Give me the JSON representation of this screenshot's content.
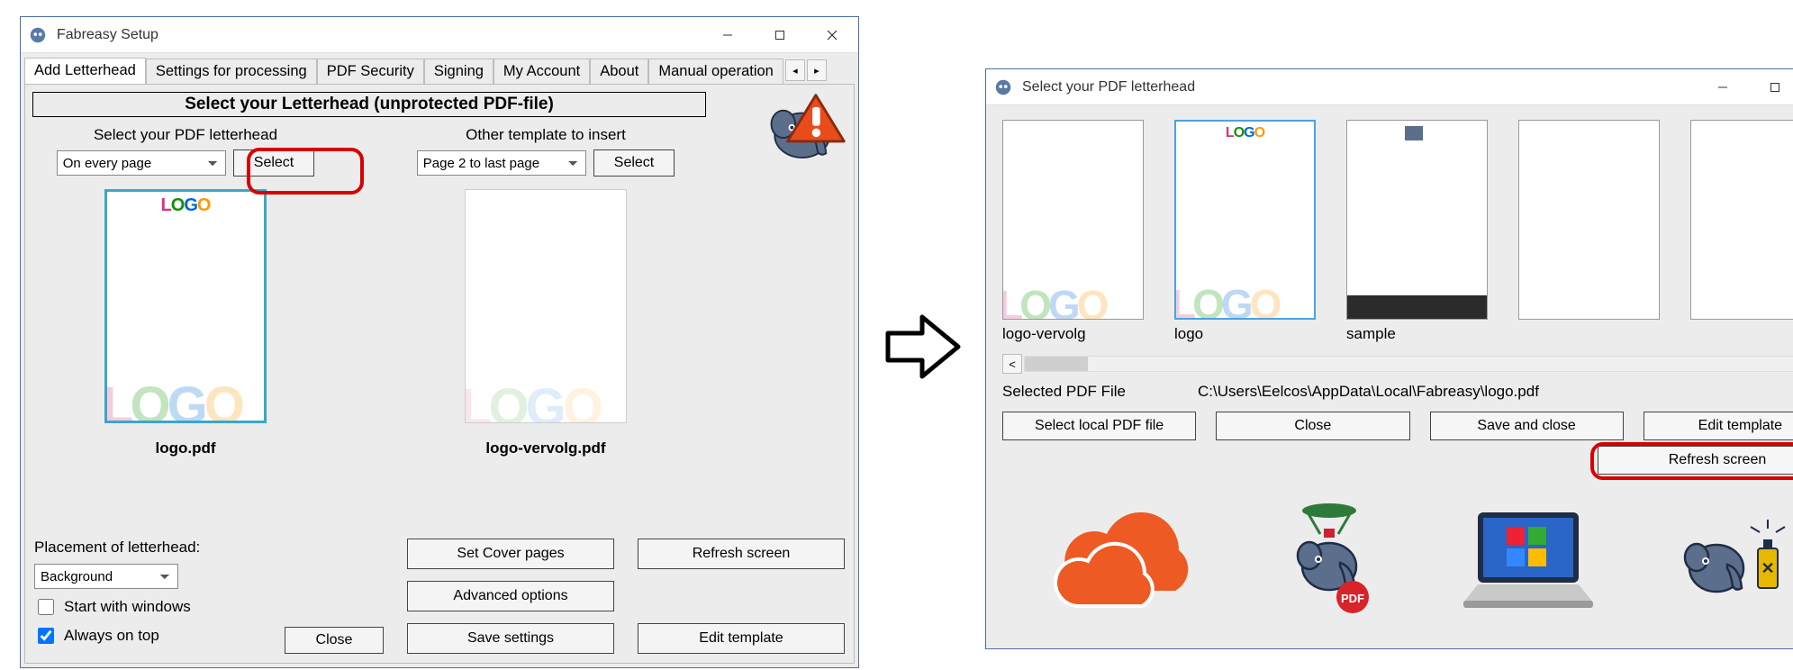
{
  "win1": {
    "title": "Fabreasy Setup",
    "tabs": [
      "Add Letterhead",
      "Settings for processing",
      "PDF Security",
      "Signing",
      "My Account",
      "About",
      "Manual operation"
    ],
    "heading": "Select your Letterhead (unprotected PDF-file)",
    "left": {
      "label": "Select your PDF letterhead",
      "dropdown": "On every page",
      "select_btn": "Select",
      "filename": "logo.pdf"
    },
    "right": {
      "label": "Other template to insert",
      "dropdown": "Page 2 to last page",
      "select_btn": "Select",
      "filename": "logo-vervolg.pdf"
    },
    "placement_label": "Placement of letterhead:",
    "placement_value": "Background",
    "start_with_windows": "Start with windows",
    "always_on_top": "Always on top",
    "btn_close": "Close",
    "btn_set_cover": "Set Cover pages",
    "btn_refresh": "Refresh screen",
    "btn_advanced": "Advanced options",
    "btn_save": "Save settings",
    "btn_edit": "Edit template"
  },
  "win2": {
    "title": "Select your PDF letterhead",
    "thumbs": [
      "logo-vervolg",
      "logo",
      "sample",
      "",
      ""
    ],
    "selected_label": "Selected PDF File",
    "selected_path": "C:\\Users\\Eelcos\\AppData\\Local\\Fabreasy\\logo.pdf",
    "btn_select_local": "Select local PDF file",
    "btn_close": "Close",
    "btn_save_close": "Save and close",
    "btn_edit": "Edit template",
    "btn_refresh": "Refresh screen"
  }
}
